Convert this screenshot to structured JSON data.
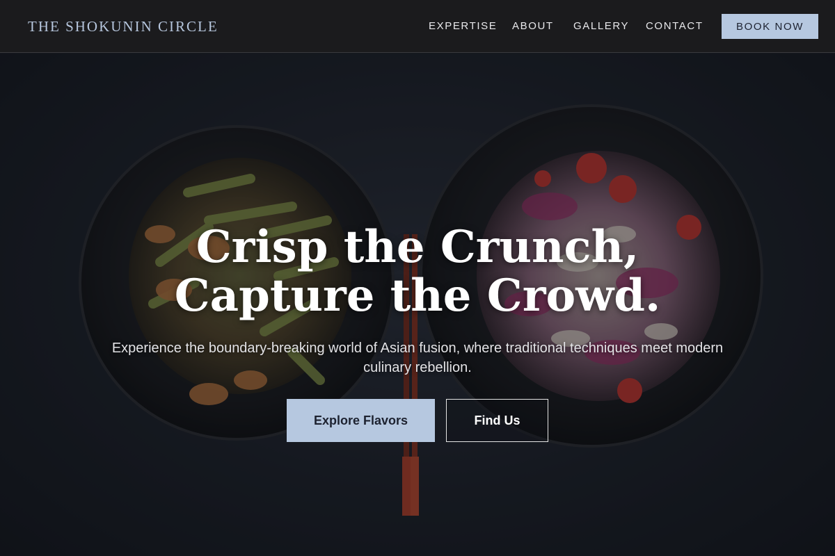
{
  "nav": {
    "brand": "THE SHOKUNIN CIRCLE",
    "links": [
      {
        "label": "EXPERTISE"
      },
      {
        "label": "ABOUT"
      },
      {
        "label": "GALLERY"
      },
      {
        "label": "CONTACT"
      }
    ],
    "cta_label": "BOOK NOW"
  },
  "hero": {
    "headline_line1": "Crisp the Crunch,",
    "headline_line2": "Capture the Crowd.",
    "subtitle": "Experience the boundary-breaking world of Asian fusion, where traditional techniques meet modern culinary rebellion.",
    "primary_button": "Explore Flavors",
    "secondary_button": "Find Us"
  },
  "colors": {
    "nav_background": "#1b1b1d",
    "accent": "#b6c8e0",
    "brand_text": "#b6c6dd",
    "hero_background": "#1c2029"
  },
  "icons": {
    "hero_image": "dark-background-bowls-of-asian-food-with-chopsticks"
  }
}
